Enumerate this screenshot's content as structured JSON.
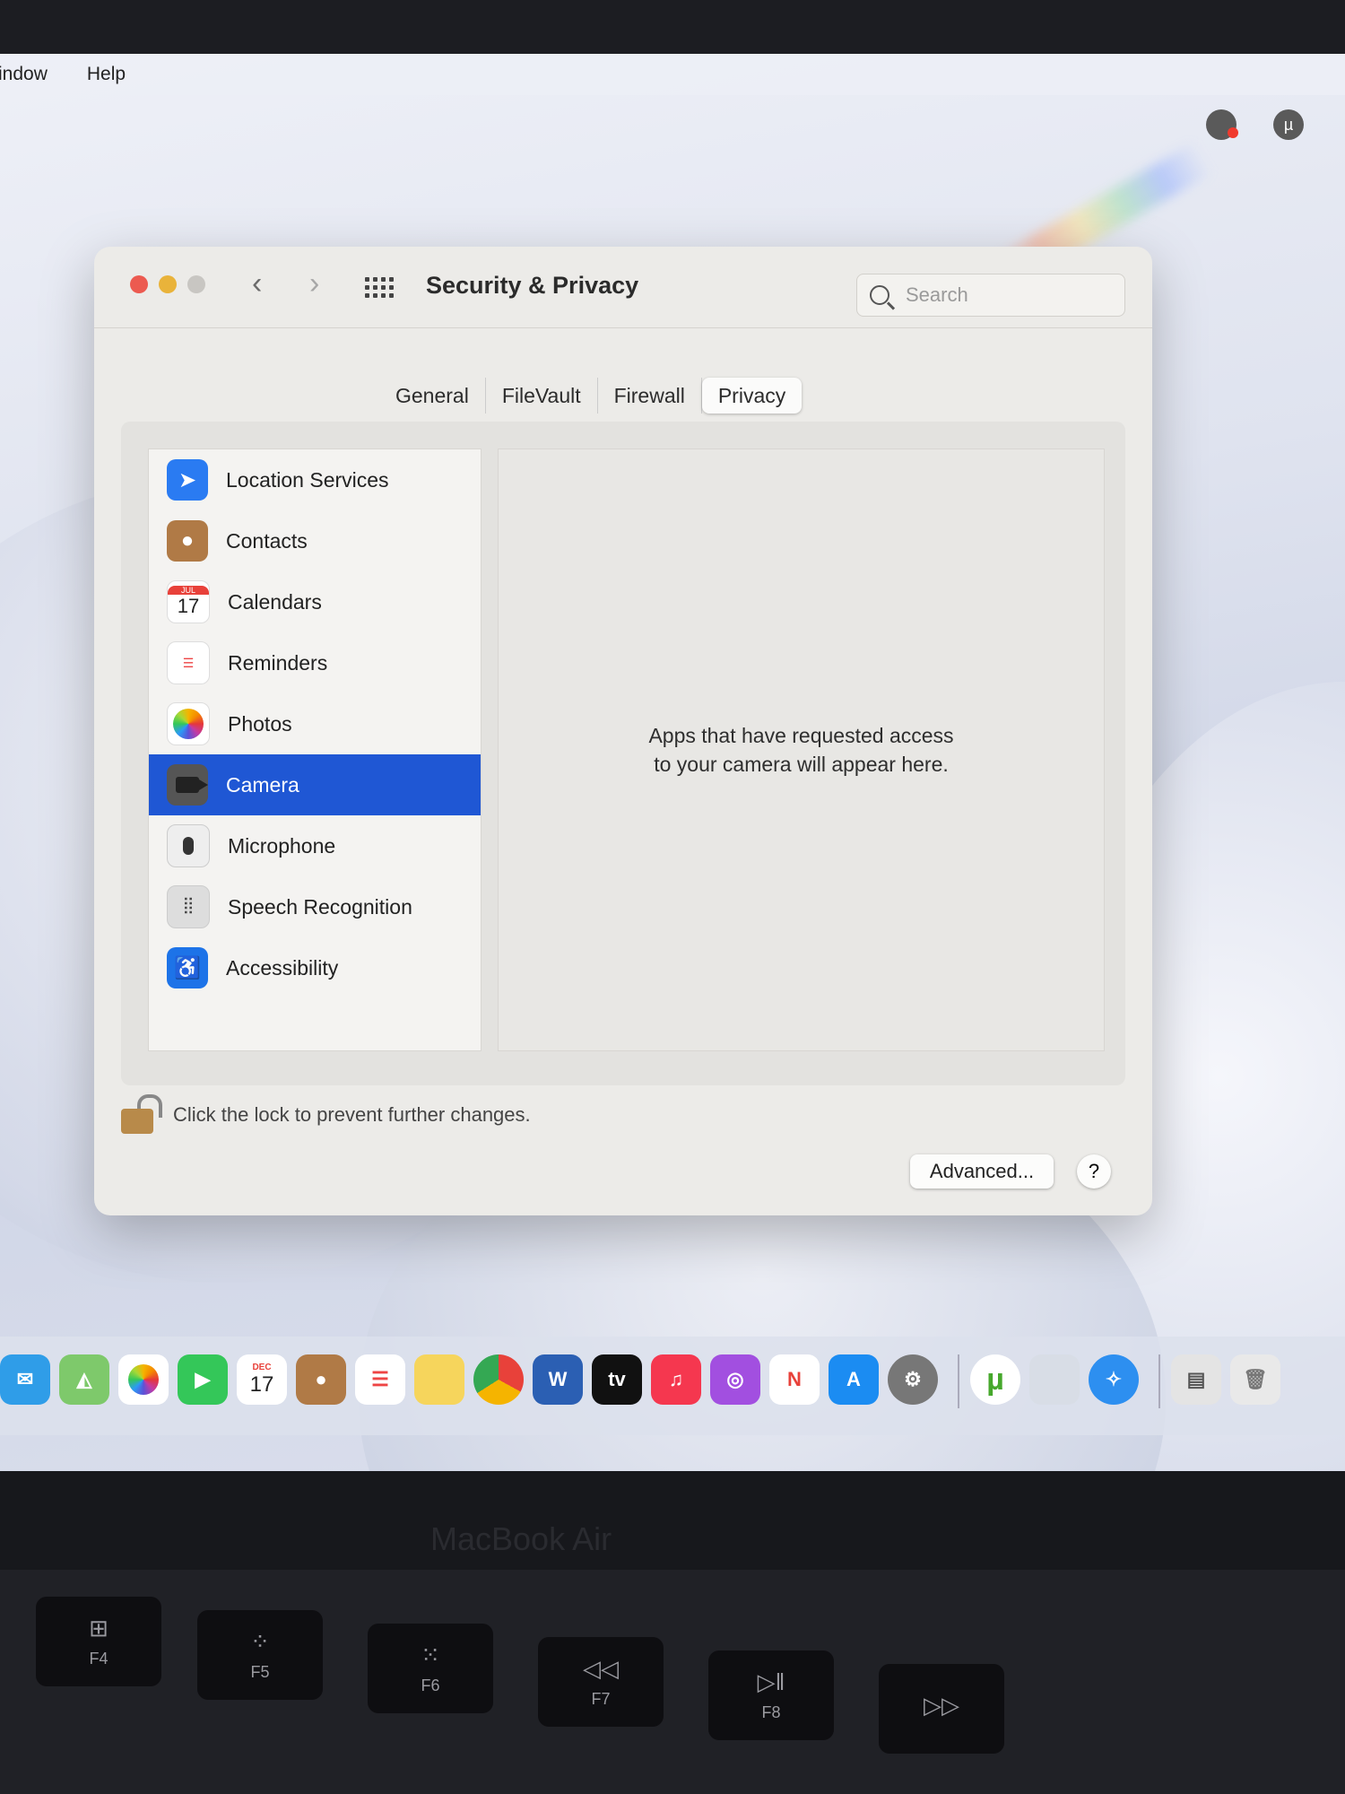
{
  "menubar": {
    "items": [
      "indow",
      "Help"
    ]
  },
  "window": {
    "title": "Security & Privacy",
    "search_placeholder": "Search",
    "tabs": [
      {
        "label": "General"
      },
      {
        "label": "FileVault"
      },
      {
        "label": "Firewall"
      },
      {
        "label": "Privacy",
        "active": true
      }
    ],
    "sidebar": [
      {
        "label": "Location Services",
        "icon": "location-arrow-icon"
      },
      {
        "label": "Contacts",
        "icon": "contacts-icon"
      },
      {
        "label": "Calendars",
        "icon": "calendar-icon",
        "icon_month": "JUL",
        "icon_day": "17"
      },
      {
        "label": "Reminders",
        "icon": "reminders-icon"
      },
      {
        "label": "Photos",
        "icon": "photos-icon"
      },
      {
        "label": "Camera",
        "icon": "camera-icon",
        "selected": true
      },
      {
        "label": "Microphone",
        "icon": "microphone-icon"
      },
      {
        "label": "Speech Recognition",
        "icon": "waveform-icon"
      },
      {
        "label": "Accessibility",
        "icon": "accessibility-icon"
      }
    ],
    "main_message": "Apps that have requested access\nto your camera will appear here.",
    "lock_text": "Click the lock to prevent further changes.",
    "advanced_label": "Advanced...",
    "help_label": "?"
  },
  "dock": {
    "calendar_month": "DEC",
    "calendar_day": "17",
    "tv_label": "tv",
    "word_label": "W",
    "torrent_label": "µ"
  },
  "hardware": {
    "label": "MacBook Air",
    "keys": [
      "F4",
      "F5",
      "F6",
      "F7",
      "F8"
    ]
  },
  "colors": {
    "selection": "#1f57d4",
    "window_bg": "#ecebe8"
  }
}
